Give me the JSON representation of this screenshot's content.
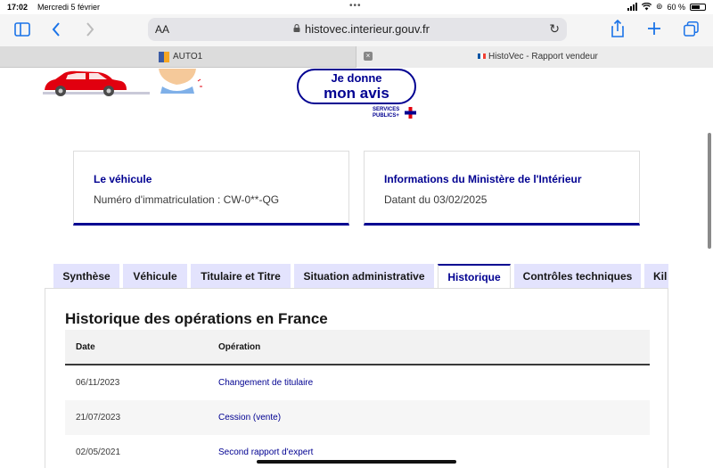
{
  "status_bar": {
    "time": "17:02",
    "date": "Mercredi 5 février",
    "battery": "60 %"
  },
  "browser": {
    "text_size_label": "AA",
    "url": "histovec.interieur.gouv.fr",
    "tabs": [
      {
        "label": "AUTO1"
      },
      {
        "label": "HistoVec - Rapport vendeur"
      }
    ]
  },
  "page": {
    "feedback_button": {
      "line1": "Je donne",
      "line2": "mon avis"
    },
    "services_publics": {
      "line1": "SERVICES",
      "line2": "PUBLICS+"
    },
    "cards": [
      {
        "title": "Le véhicule",
        "value": "Numéro d'immatriculation : CW-0**-QG"
      },
      {
        "title": "Informations du Ministère de l'Intérieur",
        "value": "Datant du 03/02/2025"
      }
    ],
    "tabs": [
      {
        "label": "Synthèse"
      },
      {
        "label": "Véhicule"
      },
      {
        "label": "Titulaire et Titre"
      },
      {
        "label": "Situation administrative"
      },
      {
        "label": "Historique"
      },
      {
        "label": "Contrôles techniques"
      },
      {
        "label": "Kil"
      }
    ],
    "active_tab": "Historique",
    "history": {
      "heading": "Historique des opérations en France",
      "columns": [
        "Date",
        "Opération"
      ],
      "rows": [
        {
          "date": "06/11/2023",
          "operation": "Changement de titulaire"
        },
        {
          "date": "21/07/2023",
          "operation": "Cession (vente)"
        },
        {
          "date": "02/05/2021",
          "operation": "Second rapport d'expert"
        }
      ]
    }
  },
  "colors": {
    "primary": "#000091",
    "tab_bg": "#e3e3fd",
    "link_blue": "#1a73e8"
  }
}
